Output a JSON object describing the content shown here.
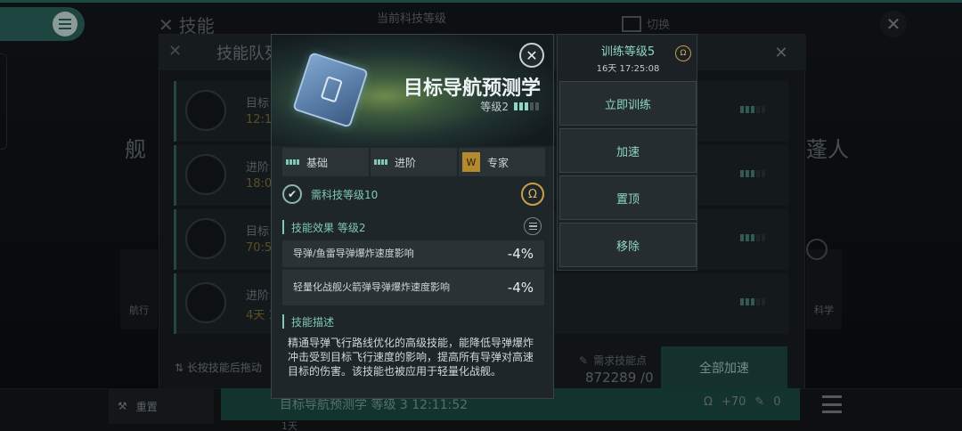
{
  "background": {
    "title": "技能",
    "tech_level_label": "当前科技等级",
    "switch_label": "切换",
    "big_left": "舰",
    "big_right": "蓬人",
    "queue_title": "技能队列",
    "queue_rows": [
      {
        "name": "目标",
        "time": "12:1"
      },
      {
        "name": "进阶",
        "time": "18:05"
      },
      {
        "name": "目标",
        "time": "70:57"
      },
      {
        "name": "进阶",
        "time": "4天 1"
      }
    ],
    "drag_hint": "长按技能后拖动",
    "need_points_label": "需求技能点",
    "need_points_value": "872289 /0",
    "all_speed_label": "全部加速",
    "side_left_label": "航行",
    "side_right_label": "科学",
    "bottom_repair": "重置",
    "bottom_current": "目标导航预测学 等级 3   12:11:52",
    "bottom_current_sub": "1天",
    "bottom_right_a": "+70",
    "bottom_right_b": "0"
  },
  "modal": {
    "skill_name": "目标导航预测学",
    "level_label": "等级2",
    "level_filled": 3,
    "level_total": 5,
    "tiers": [
      {
        "label": "基础"
      },
      {
        "label": "进阶"
      },
      {
        "label": "专家",
        "badge": "W"
      }
    ],
    "requirement": "需科技等级10",
    "effect_section": "技能效果 等级2",
    "effects": [
      {
        "name": "导弹/鱼雷导弹爆炸速度影响",
        "value": "-4%"
      },
      {
        "name": "轻量化战舰火箭弹导弹爆炸速度影响",
        "value": "-4%"
      }
    ],
    "desc_section": "技能描述",
    "description": "精通导弹飞行路线优化的高级技能，能降低导弹爆炸冲击受到目标飞行速度的影响，提高所有导弹对高速目标的伤害。该技能也被应用于轻量化战舰。"
  },
  "actions": {
    "train_level": "训练等级5",
    "train_time": "16天 17:25:08",
    "buttons": [
      "立即训练",
      "加速",
      "置顶",
      "移除"
    ]
  },
  "colors": {
    "accent": "#7fc7b8",
    "primary_bg": "#1f2629",
    "gold": "#c9a04a"
  }
}
